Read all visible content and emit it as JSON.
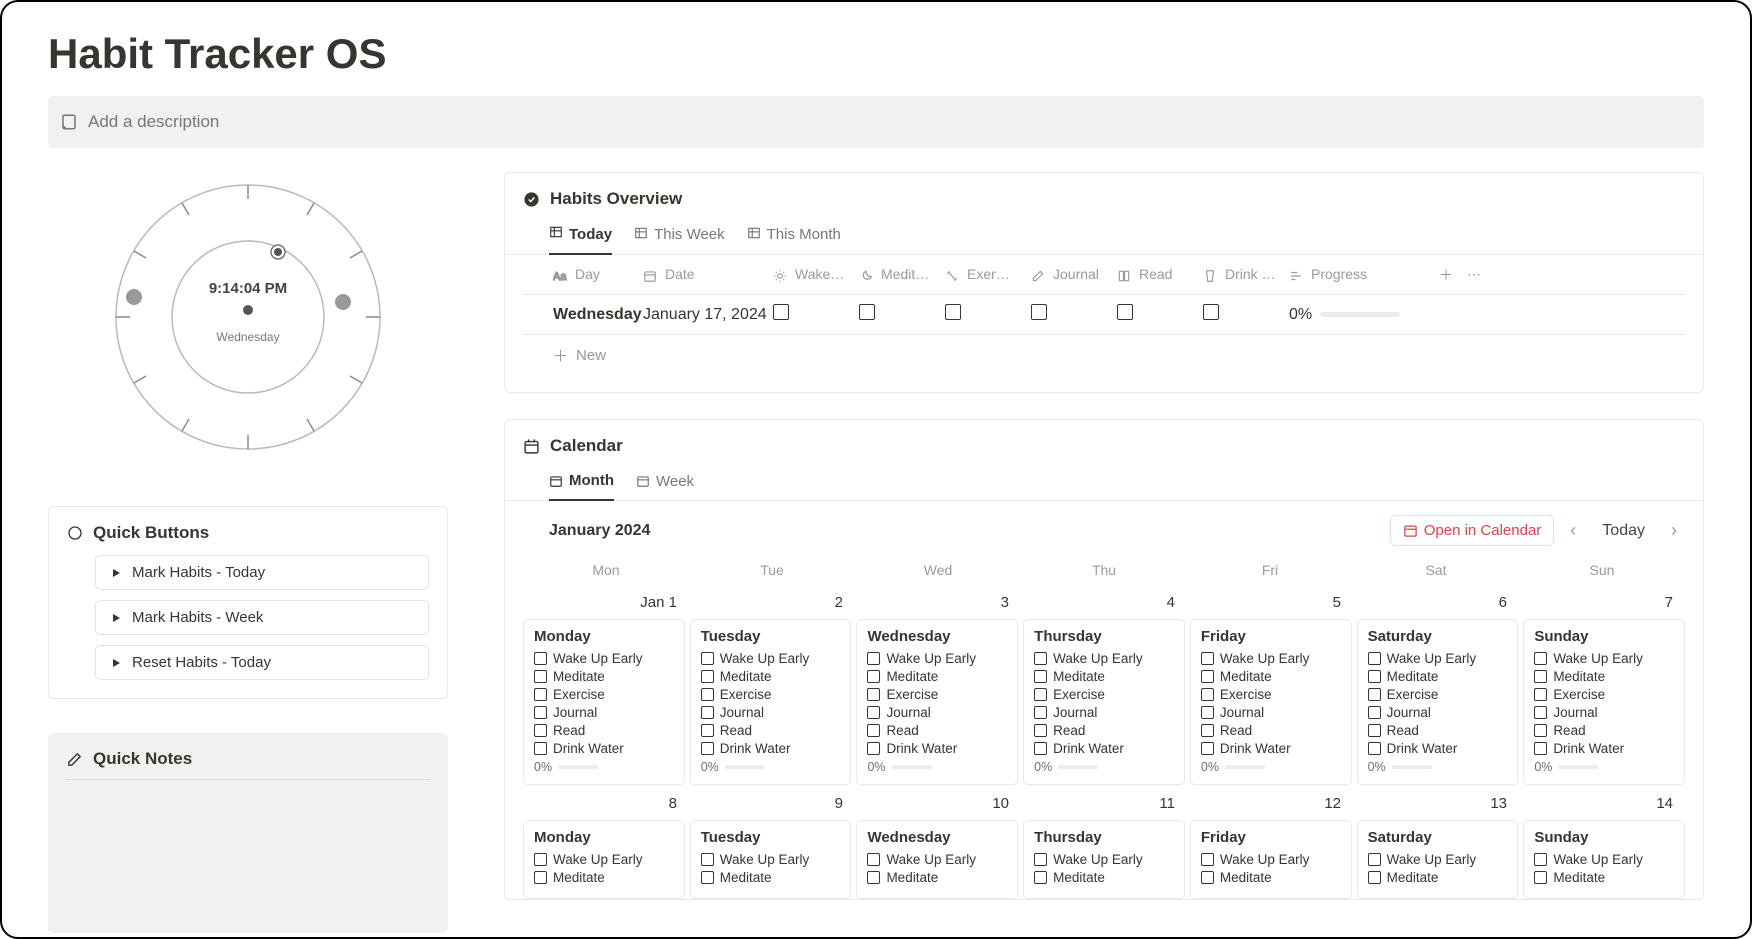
{
  "page_title": "Habit Tracker OS",
  "description_placeholder": "Add a description",
  "clock": {
    "time": "9:14:04 PM",
    "day": "Wednesday"
  },
  "quick_buttons": {
    "heading": "Quick Buttons",
    "items": [
      "Mark Habits - Today",
      "Mark Habits - Week",
      "Reset Habits - Today"
    ]
  },
  "quick_notes": {
    "heading": "Quick Notes"
  },
  "habits_overview": {
    "heading": "Habits Overview",
    "tabs": [
      "Today",
      "This Week",
      "This Month"
    ],
    "active_tab": 0,
    "columns": [
      "Day",
      "Date",
      "Wake…",
      "Medit…",
      "Exer…",
      "Journal",
      "Read",
      "Drink …",
      "Progress"
    ],
    "row": {
      "day": "Wednesday",
      "date": "January 17, 2024",
      "progress": "0%"
    },
    "new_label": "New"
  },
  "calendar": {
    "heading": "Calendar",
    "tabs": [
      "Month",
      "Week"
    ],
    "active_tab": 0,
    "month_label": "January 2024",
    "open_in_calendar": "Open in Calendar",
    "today_label": "Today",
    "weekdays": [
      "Mon",
      "Tue",
      "Wed",
      "Thu",
      "Fri",
      "Sat",
      "Sun"
    ],
    "habits": [
      "Wake Up Early",
      "Meditate",
      "Exercise",
      "Journal",
      "Read",
      "Drink Water"
    ],
    "progress_label": "0%",
    "weeks": [
      {
        "date_labels": [
          "Jan 1",
          "2",
          "3",
          "4",
          "5",
          "6",
          "7"
        ],
        "day_names": [
          "Monday",
          "Tuesday",
          "Wednesday",
          "Thursday",
          "Friday",
          "Saturday",
          "Sunday"
        ],
        "full": true
      },
      {
        "date_labels": [
          "8",
          "9",
          "10",
          "11",
          "12",
          "13",
          "14"
        ],
        "day_names": [
          "Monday",
          "Tuesday",
          "Wednesday",
          "Thursday",
          "Friday",
          "Saturday",
          "Sunday"
        ],
        "full": false
      }
    ]
  }
}
